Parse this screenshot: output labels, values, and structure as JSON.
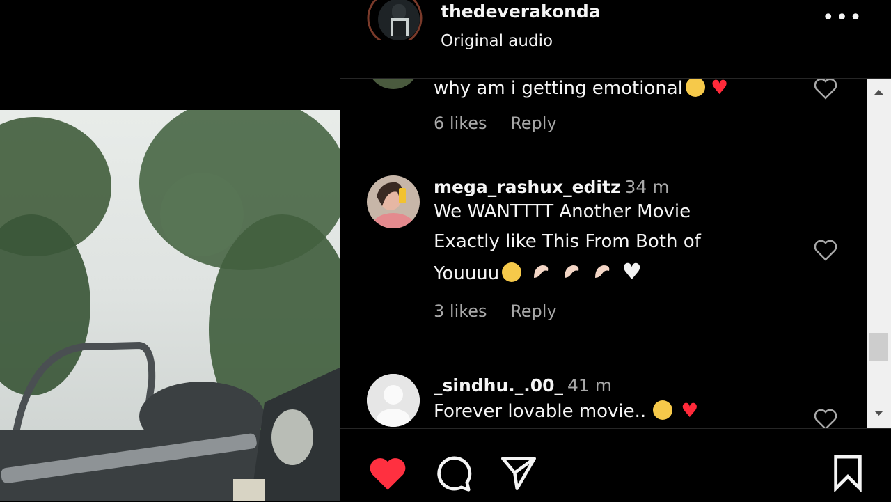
{
  "header": {
    "username": "thedeverakonda",
    "subtitle": "Original audio",
    "more_label": "•••"
  },
  "comments": [
    {
      "username": "",
      "time": "",
      "text": "why am i getting emotional",
      "emojis": [
        "pleading-face",
        "red-heart"
      ],
      "likes": "6 likes",
      "reply": "Reply"
    },
    {
      "username": "mega_rashux_editz",
      "time": "34 m",
      "text_lines": [
        "We WANTTTT Another Movie",
        "Exactly like This From Both of",
        "Youuuu"
      ],
      "emojis": [
        "pleading-face",
        "pinching-hand",
        "pinching-hand",
        "pinching-hand",
        "white-heart"
      ],
      "likes": "3 likes",
      "reply": "Reply"
    },
    {
      "username": "_sindhu._.00_",
      "time": "41 m",
      "text": "Forever lovable movie..",
      "emojis": [
        "star-struck",
        "red-heart"
      ]
    }
  ],
  "footer": {
    "icons": [
      "heart-filled-icon",
      "comment-icon",
      "share-icon",
      "bookmark-icon"
    ]
  },
  "colors": {
    "background": "#000000",
    "text": "#f5f5f5",
    "muted": "#a8a8a8",
    "like_red": "#ff3040",
    "scrollbar_track": "#f0f0f0"
  }
}
